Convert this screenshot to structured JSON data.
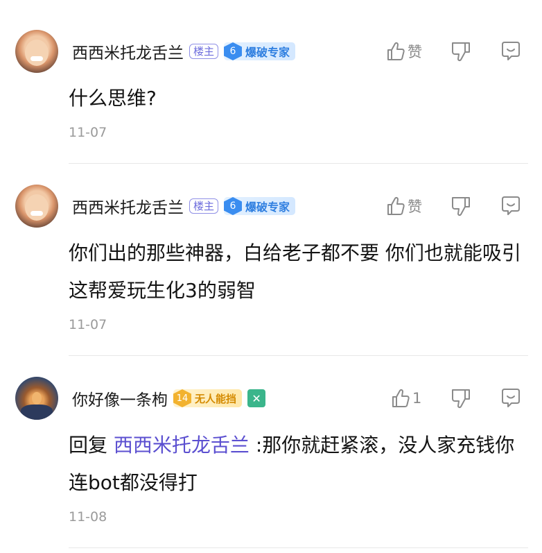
{
  "comments": [
    {
      "username": "西西米托龙舌兰",
      "op_tag": "楼主",
      "badge_level": "6",
      "badge_label": "爆破专家",
      "like_label": "赞",
      "content": "什么思维?",
      "date": "11-07"
    },
    {
      "username": "西西米托龙舌兰",
      "op_tag": "楼主",
      "badge_level": "6",
      "badge_label": "爆破专家",
      "like_label": "赞",
      "content": "你们出的那些神器，白给老子都不要 你们也就能吸引这帮爱玩生化3的弱智",
      "date": "11-07"
    },
    {
      "username": "你好像一条枸",
      "badge_level": "14",
      "badge_label": "无人能挡",
      "like_label": "1",
      "reply_prefix": "回复 ",
      "reply_to": "西西米托龙舌兰",
      "content": " :那你就赶紧滚，没人家充钱你连bot都没得打",
      "date": "11-08"
    }
  ],
  "icons": {
    "like": "thumbs-up-icon",
    "dislike": "thumbs-down-icon",
    "reply": "comment-bubble-icon",
    "extra_badge": "x-square-badge-icon"
  },
  "colors": {
    "mention": "#5b4fd0",
    "op_tag": "#6b6bdc",
    "badge_blue": "#3a8df0",
    "badge_gold": "#f2b22f",
    "badge_green": "#3bb58b",
    "meta_gray": "#9a9a9a"
  }
}
